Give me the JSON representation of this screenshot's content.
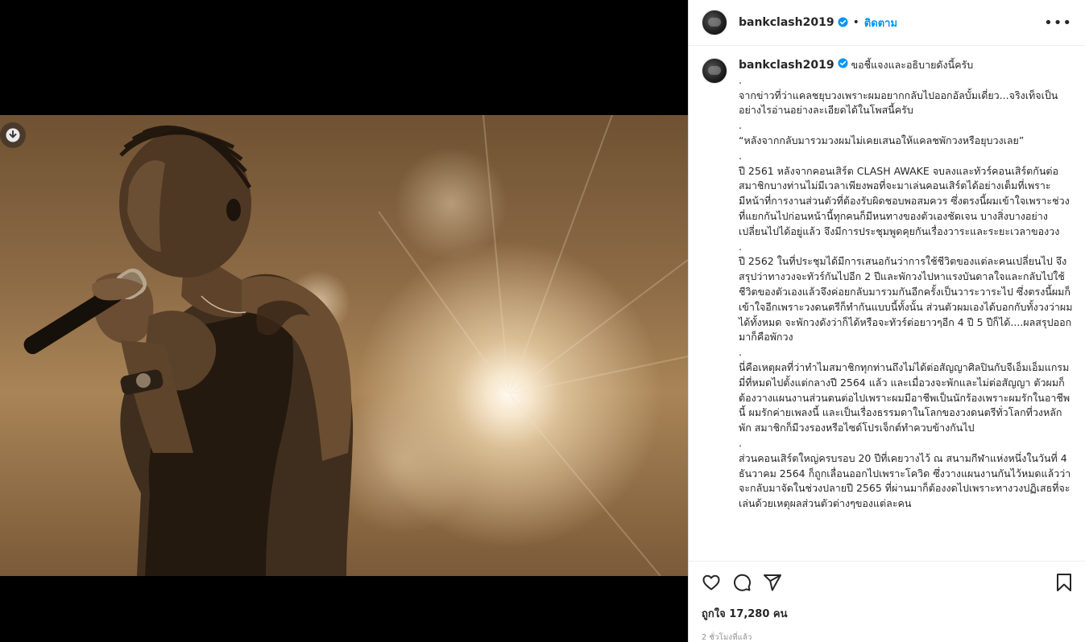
{
  "post": {
    "username": "bankclash2019",
    "follow_label": "ติดตาม",
    "dot": "•",
    "more_label": "•••",
    "caption": {
      "lead": "ขอชี้แจงและอธิบายดังนี้ครับ",
      "paragraphs": [
        ".",
        "จากข่าวที่ว่าแคลชยุบวงเพราะผมอยากกลับไปออกอัลบั้มเดี่ยว...จริงเท็จเป็นอย่างไรอ่านอย่างละเอียดได้ในโพสนี้ครับ",
        ".",
        "“หลังจากกลับมารวมวงผมไม่เคยเสนอให้แคลชพักวงหรือยุบวงเลย”",
        ".",
        "ปี 2561 หลังจากคอนเสิร์ต CLASH AWAKE จบลงและทัวร์คอนเสิร์ตกันต่อ สมาชิกบางท่านไม่มีเวลาเพียงพอที่จะมาเล่นคอนเสิร์ตได้อย่างเต็มที่เพราะมีหน้าที่การงานส่วนตัวที่ต้องรับผิดชอบพอสมควร ซึ่งตรงนี้ผมเข้าใจเพราะช่วงที่แยกกันไปก่อนหน้านี้ทุกคนก็มีหนทางของตัวเองชัดเจน บางสิ่งบางอย่างเปลี่ยนไปได้อยู่แล้ว จึงมีการประชุมพูดคุยกันเรื่องวาระและระยะเวลาของวง",
        ".",
        "ปี 2562 ในที่ประชุมได้มีการเสนอกันว่าการใช้ชีวิตของแต่ละคนเปลี่ยนไป จึงสรุปว่าทางวงจะทัวร์กันไปอีก 2 ปีและพักวงไปหาแรงบันดาลใจและกลับไปใช้ชีวิตของตัวเองแล้วจึงค่อยกลับมารวมกันอีกครั้งเป็นวาระวาระไป ซึ่งตรงนี้ผมก็เข้าใจอีกเพราะวงดนตรีก็ทำกันแบบนี้ทั้งนั้น ส่วนตัวผมเองได้บอกกับทั้งวงว่าผมได้ทั้งหมด จะพักวงดังว่าก็ได้หรือจะทัวร์ต่อยาวๆอีก 4 ปี 5 ปีก็ได้....ผลสรุปออกมาก็คือพักวง",
        ".",
        "นี่คือเหตุผลที่ว่าทำไมสมาชิกทุกท่านถึงไม่ได้ต่อสัญญาศิลปินกับจีเอ็มเอ็มแกรมมี่ที่หมดไปตั้งแต่กลางปี 2564 แล้ว และเมื่อวงจะพักและไม่ต่อสัญญา ตัวผมก็ต้องวางแผนงานส่วนตนต่อไปเพราะผมมีอาชีพเป็นนักร้องเพราะผมรักในอาชีพนี้ ผมรักค่ายเพลงนี้ และเป็นเรื่องธรรมดาในโลกของวงดนตรีทั่วโลกที่วงหลักพัก สมาชิกก็มีวงรองหรือไซด์โปรเจ็กต์ทำควบข้างกันไป",
        ".",
        "ส่วนคอนเสิร์ตใหญ่ครบรอบ 20 ปีที่เคยวางไว้ ณ สนามกีฬาแห่งหนึ่งในวันที่ 4 ธันวาคม 2564 ก็ถูกเลื่อนออกไปเพราะโควิด ซึ่งวางแผนงานกันไว้หมดแล้วว่าจะกลับมาจัดในช่วงปลายปี 2565 ที่ผ่านมาก็ต้องงดไปเพราะทางวงปฏิเสธที่จะเล่นด้วยเหตุผลส่วนตัวต่างๆของแต่ละคน"
      ]
    },
    "likes_text": "ถูกใจ 17,280 คน",
    "time_text": "2 ชั่วโมงที่แล้ว"
  },
  "icons": {
    "like": "heart-icon",
    "comment": "comment-icon",
    "share": "share-icon",
    "save": "bookmark-icon",
    "download": "download-icon",
    "verified": "verified-badge-icon"
  },
  "colors": {
    "follow": "#0095f6",
    "verified": "#0095f6",
    "photo_tone": "#a98457"
  }
}
